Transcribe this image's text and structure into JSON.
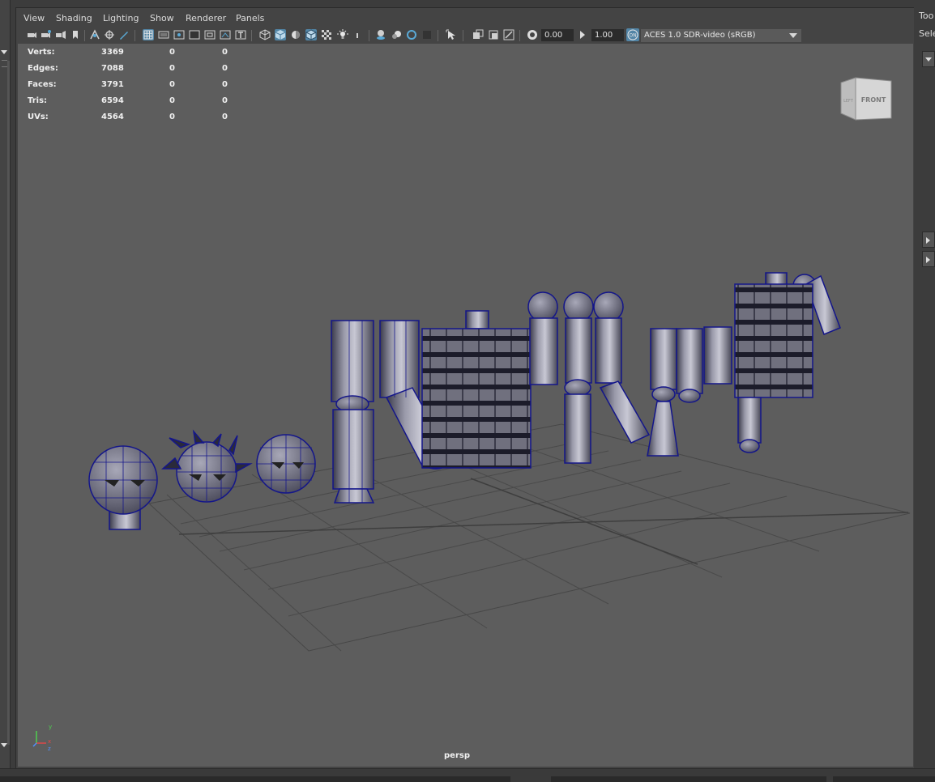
{
  "menu": {
    "items": [
      {
        "label": "View"
      },
      {
        "label": "Shading"
      },
      {
        "label": "Lighting"
      },
      {
        "label": "Show"
      },
      {
        "label": "Renderer"
      },
      {
        "label": "Panels"
      }
    ]
  },
  "toolbar": {
    "exposure_value": "0.00",
    "gamma_value": "1.00",
    "color_management_icon": "on-icon",
    "color_space": "ACES 1.0 SDR-video (sRGB)"
  },
  "hud": {
    "columns": 3,
    "rows": [
      {
        "label": "Verts:",
        "values": [
          "3369",
          "0",
          "0"
        ]
      },
      {
        "label": "Edges:",
        "values": [
          "7088",
          "0",
          "0"
        ]
      },
      {
        "label": "Faces:",
        "values": [
          "3791",
          "0",
          "0"
        ]
      },
      {
        "label": "Tris:",
        "values": [
          "6594",
          "0",
          "0"
        ]
      },
      {
        "label": "UVs:",
        "values": [
          "4564",
          "0",
          "0"
        ]
      }
    ]
  },
  "viewport": {
    "camera": "persp",
    "background_color": "#5d5d5d",
    "wire_color": "#14168a",
    "grid_color": "#4a4a4a"
  },
  "viewcube": {
    "front_label": "FRONT",
    "side_label": "LEFT"
  },
  "right_panel": {
    "tab_label": "Too",
    "select_label": "Sele"
  },
  "axes": {
    "x": "x",
    "y": "y",
    "z": "z"
  },
  "colors": {
    "accent": "#5285a6",
    "panel_bg": "#444444",
    "mesh_fill": "#6a6a78"
  }
}
